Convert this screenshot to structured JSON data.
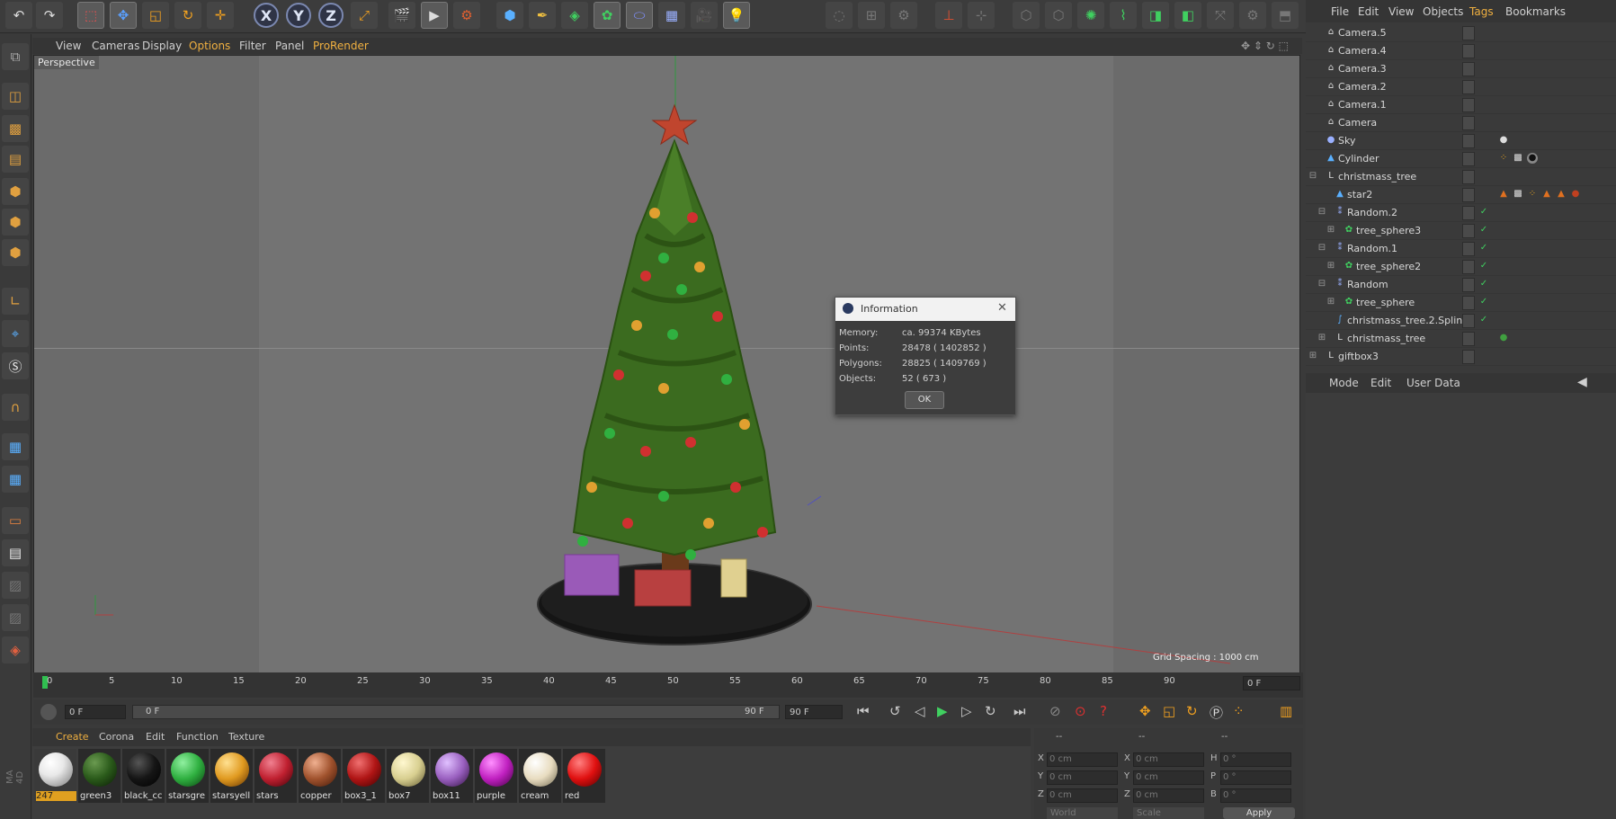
{
  "toolbar": {
    "axis_x": "X",
    "axis_y": "Y",
    "axis_z": "Z"
  },
  "viewport": {
    "menu": [
      "View",
      "Cameras",
      "Display",
      "Options",
      "Filter",
      "Panel",
      "ProRender"
    ],
    "label": "Perspective",
    "grid_spacing": "Grid Spacing : 1000 cm"
  },
  "info_dialog": {
    "title": "Information",
    "memory_label": "Memory:",
    "memory_value": "ca. 99374 KBytes",
    "points_label": "Points:",
    "points_value": "28478 ( 1402852 )",
    "polygons_label": "Polygons:",
    "polygons_value": "28825 ( 1409769 )",
    "objects_label": "Objects:",
    "objects_value": "52 ( 673 )",
    "ok_label": "OK"
  },
  "timeline": {
    "ticks": [
      "0",
      "5",
      "10",
      "15",
      "20",
      "25",
      "30",
      "35",
      "40",
      "45",
      "50",
      "55",
      "60",
      "65",
      "70",
      "75",
      "80",
      "85",
      "90"
    ],
    "current_frame": "0 F",
    "start_frame": "0 F",
    "range_start": "0 F",
    "range_end": "90 F",
    "end_frame": "90 F"
  },
  "materials": {
    "menu": [
      "Create",
      "Corona",
      "Edit",
      "Function",
      "Texture"
    ],
    "items": [
      {
        "name": "247",
        "color": "#e8e8e8"
      },
      {
        "name": "green3",
        "color": "#2a5a1a"
      },
      {
        "name": "black_cc",
        "color": "#151515"
      },
      {
        "name": "starsgre",
        "color": "#2fb040"
      },
      {
        "name": "starsyell",
        "color": "#e09a20"
      },
      {
        "name": "stars",
        "color": "#c02030"
      },
      {
        "name": "copper",
        "color": "#a0522d"
      },
      {
        "name": "box3_1",
        "color": "#b01515"
      },
      {
        "name": "box7",
        "color": "#d8cf90"
      },
      {
        "name": "box11",
        "color": "#9a60c0"
      },
      {
        "name": "purple",
        "color": "#c020c0"
      },
      {
        "name": "cream",
        "color": "#e8dcc0"
      },
      {
        "name": "red",
        "color": "#e01010"
      }
    ]
  },
  "coordinates": {
    "header": [
      "--",
      "--",
      "--"
    ],
    "row_labels_a": [
      "X",
      "Y",
      "Z"
    ],
    "row_labels_b": [
      "X",
      "Y",
      "Z"
    ],
    "row_labels_c": [
      "H",
      "P",
      "B"
    ],
    "values_a": [
      "0 cm",
      "0 cm",
      "0 cm"
    ],
    "values_b": [
      "0 cm",
      "0 cm",
      "0 cm"
    ],
    "values_c": [
      "0 °",
      "0 °",
      "0 °"
    ],
    "world_label": "World",
    "scale_label": "Scale",
    "apply_label": "Apply"
  },
  "object_manager": {
    "menu": [
      "File",
      "Edit",
      "View",
      "Objects",
      "Tags",
      "Bookmarks"
    ],
    "objects": [
      {
        "name": "Camera.5",
        "icon": "camera-icon"
      },
      {
        "name": "Camera.4",
        "icon": "camera-icon"
      },
      {
        "name": "Camera.3",
        "icon": "camera-icon"
      },
      {
        "name": "Camera.2",
        "icon": "camera-icon"
      },
      {
        "name": "Camera.1",
        "icon": "camera-icon"
      },
      {
        "name": "Camera",
        "icon": "camera-icon"
      },
      {
        "name": "Sky",
        "icon": "sky-icon"
      },
      {
        "name": "Cylinder",
        "icon": "cylinder-icon"
      },
      {
        "name": "christmass_tree",
        "icon": "null-icon"
      },
      {
        "name": "star2",
        "icon": "star-icon"
      },
      {
        "name": "Random.2",
        "icon": "random-effector-icon"
      },
      {
        "name": "tree_sphere3",
        "icon": "cloner-icon"
      },
      {
        "name": "Random.1",
        "icon": "random-effector-icon"
      },
      {
        "name": "tree_sphere2",
        "icon": "cloner-icon"
      },
      {
        "name": "Random",
        "icon": "random-effector-icon"
      },
      {
        "name": "tree_sphere",
        "icon": "cloner-icon"
      },
      {
        "name": "christmass_tree.2.Spline",
        "icon": "spline-icon"
      },
      {
        "name": "christmass_tree",
        "icon": "null-icon"
      },
      {
        "name": "giftbox3",
        "icon": "null-icon"
      }
    ]
  },
  "attributes": {
    "menu": [
      "Mode",
      "Edit",
      "User Data"
    ]
  },
  "app_label": "MA 4D"
}
